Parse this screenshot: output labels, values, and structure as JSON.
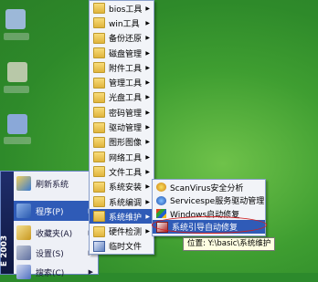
{
  "start_menu": {
    "sidebar_text": "E 2003",
    "items": [
      {
        "label": "刷新系统",
        "has_arrow": false
      },
      {
        "label": "程序(P)",
        "has_arrow": true,
        "active": true
      },
      {
        "label": "收藏夹(A)",
        "has_arrow": true
      },
      {
        "label": "设置(S)",
        "has_arrow": true
      },
      {
        "label": "搜索(C)",
        "has_arrow": true
      }
    ]
  },
  "programs_menu": {
    "items": [
      {
        "label": "bios工具",
        "arrow": true
      },
      {
        "label": "win工具",
        "arrow": true
      },
      {
        "label": "备份还原",
        "arrow": true
      },
      {
        "label": "磁盘管理",
        "arrow": true
      },
      {
        "label": "附件工具",
        "arrow": true
      },
      {
        "label": "管理工具",
        "arrow": true
      },
      {
        "label": "光盘工具",
        "arrow": true
      },
      {
        "label": "密码管理",
        "arrow": true
      },
      {
        "label": "驱动管理",
        "arrow": true
      },
      {
        "label": "图形图像",
        "arrow": true
      },
      {
        "label": "网络工具",
        "arrow": true
      },
      {
        "label": "文件工具",
        "arrow": true
      },
      {
        "label": "系统安装",
        "arrow": true
      },
      {
        "label": "系统编调",
        "arrow": true
      },
      {
        "label": "系统维护",
        "arrow": true,
        "active": true
      },
      {
        "label": "硬件检测",
        "arrow": true
      },
      {
        "label": "临时文件",
        "arrow": false
      }
    ]
  },
  "maintenance_menu": {
    "items": [
      {
        "label": "ScanVirus安全分析"
      },
      {
        "label": "Servicespe服务驱动管理"
      },
      {
        "label": "Windows启动修复"
      },
      {
        "label": "系统引导自动修复",
        "active": true
      }
    ]
  },
  "tooltip": {
    "text": "位置: Y:\\basic\\系统维护"
  }
}
